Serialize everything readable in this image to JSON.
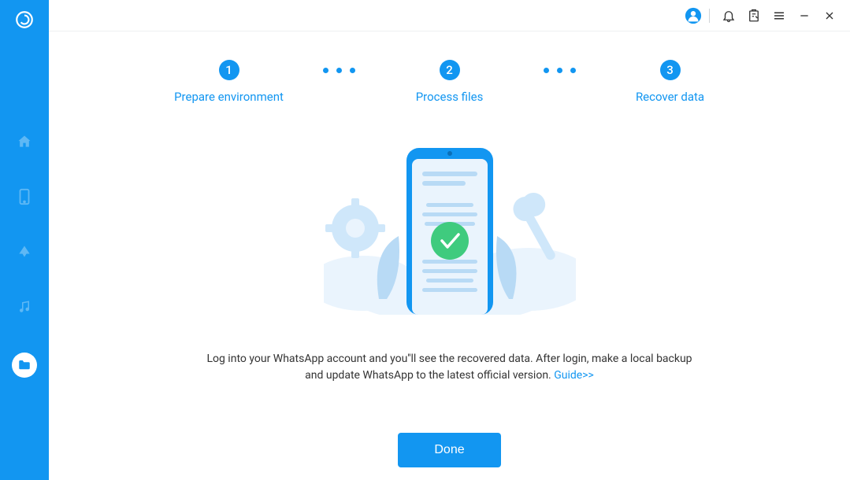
{
  "colors": {
    "primary": "#1296f1",
    "success": "#3fcb7e"
  },
  "sidebar": {
    "items": [
      {
        "name": "home-icon"
      },
      {
        "name": "phone-icon"
      },
      {
        "name": "cloud-icon"
      },
      {
        "name": "music-icon"
      },
      {
        "name": "folder-icon",
        "active": true
      }
    ]
  },
  "titlebar": {
    "account": "account-icon",
    "notifications": "bell-icon",
    "feedback": "clipboard-icon",
    "menu": "menu-icon",
    "minimize": "minimize-icon",
    "close": "close-icon"
  },
  "stepper": {
    "steps": [
      {
        "num": "1",
        "label": "Prepare environment"
      },
      {
        "num": "2",
        "label": "Process files"
      },
      {
        "num": "3",
        "label": "Recover data"
      }
    ]
  },
  "instruction": {
    "text_part1": "Log into your WhatsApp account and you''ll see the recovered data. After login, make a local backup and update WhatsApp to the latest official version. ",
    "guide_label": "Guide>>"
  },
  "actions": {
    "done_label": "Done"
  }
}
